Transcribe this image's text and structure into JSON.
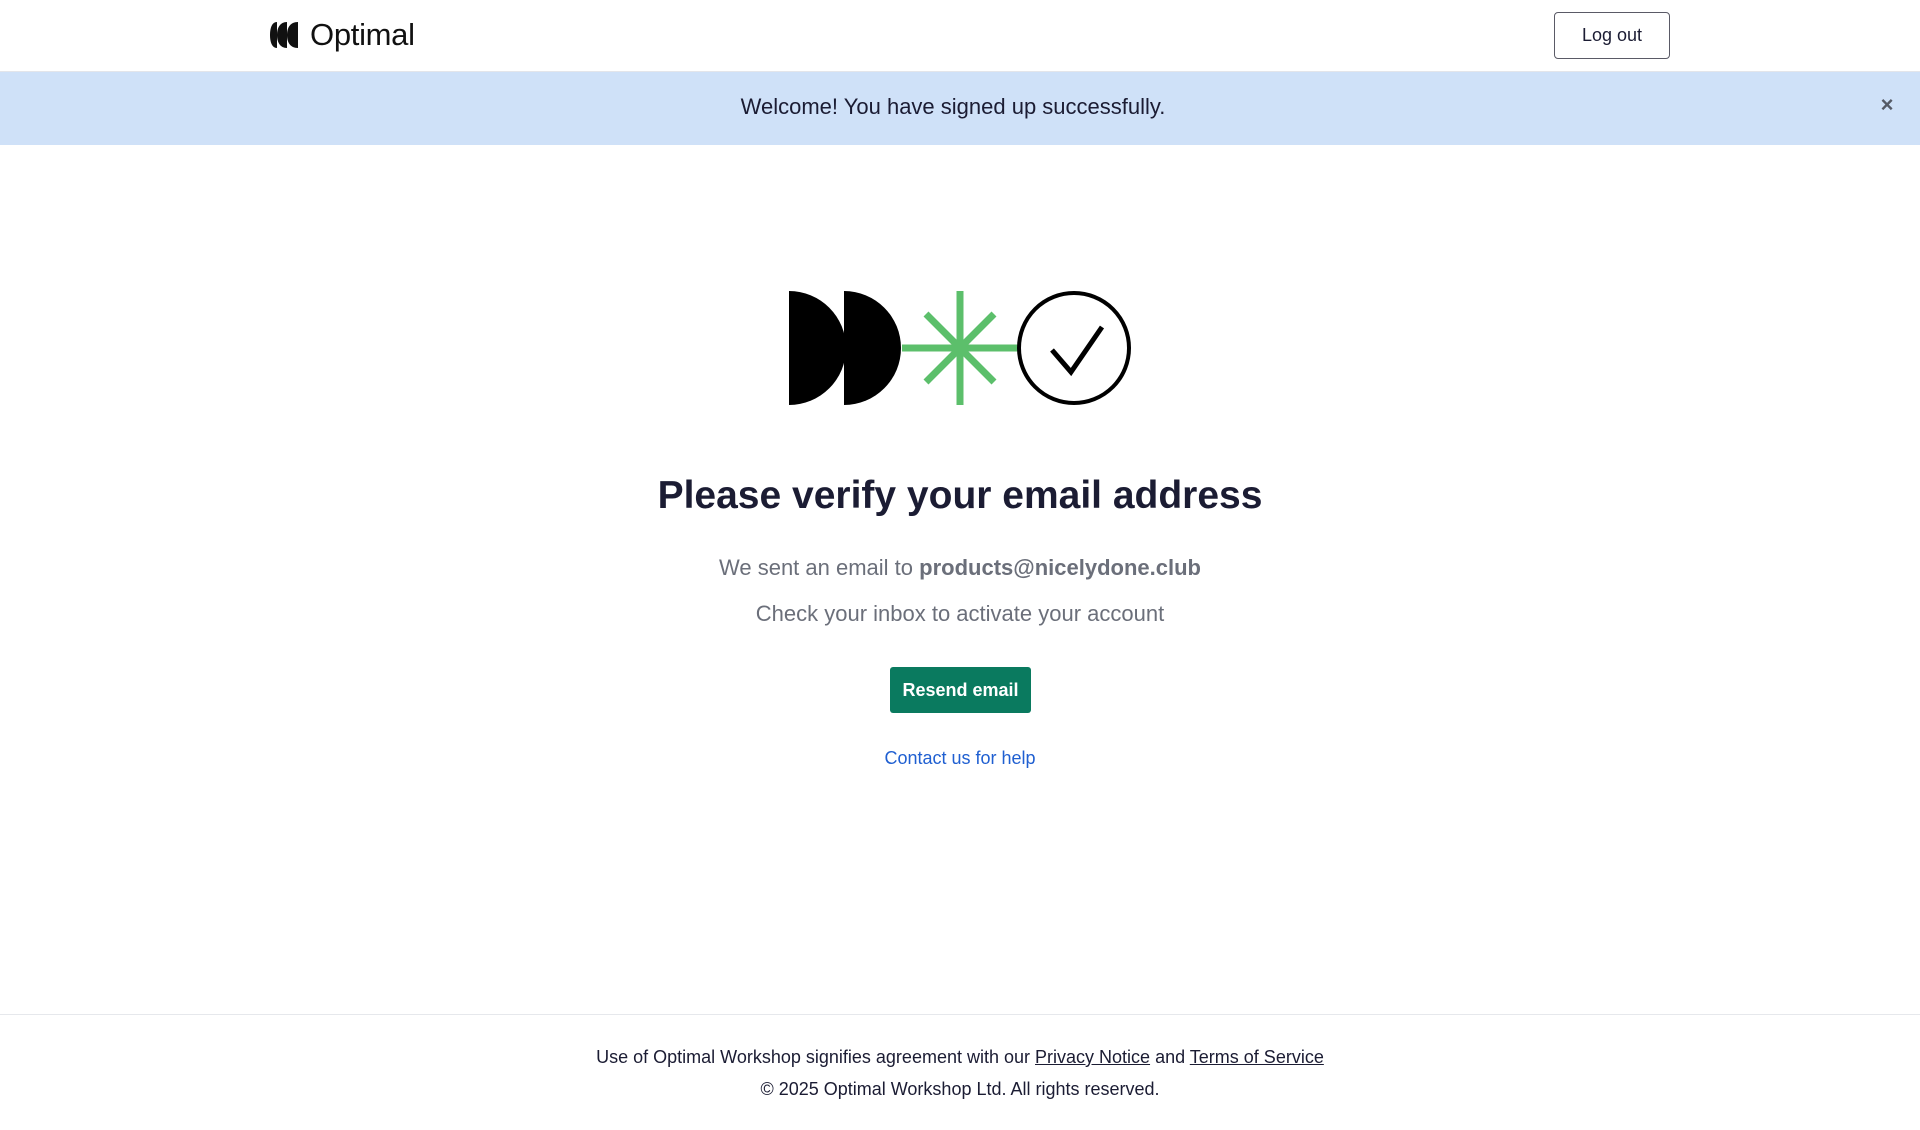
{
  "header": {
    "brand": "Optimal",
    "logout_label": "Log out"
  },
  "banner": {
    "message": "Welcome! You have signed up successfully.",
    "close_glyph": "×",
    "background": "#cfe1f8"
  },
  "main": {
    "title": "Please verify your email address",
    "sent_prefix": "We sent an email to",
    "email": "products@nicelydone.club",
    "check_text": "Check your inbox to activate your account",
    "resend_label": "Resend email",
    "help_link": "Contact us for help"
  },
  "footer": {
    "agreement_prefix": "Use of Optimal Workshop signifies agreement with our",
    "privacy_link": "Privacy Notice",
    "and_text": "and",
    "terms_link": "Terms of Service",
    "copyright": "© 2025 Optimal Workshop Ltd. All rights reserved."
  },
  "colors": {
    "accent_green": "#0a7a5f",
    "illustration_green": "#5cbf6b",
    "link_blue": "#1f5fd1",
    "heading": "#1b1c33",
    "muted_text": "#6b6f7a"
  },
  "icons": {
    "logo": "optimal-logo-mark",
    "banner_close": "close-icon",
    "illustration": [
      "half-disc-shape",
      "half-disc-shape",
      "asterisk-icon",
      "check-circle-icon"
    ]
  }
}
